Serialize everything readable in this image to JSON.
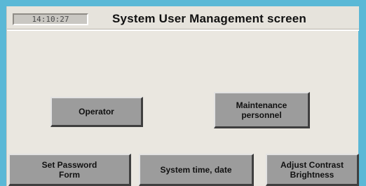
{
  "header": {
    "clock": "14:10:27",
    "title": "System User Management screen"
  },
  "buttons": {
    "operator": "Operator",
    "maintenance": "Maintenance\npersonnel",
    "set_password": "Set Password\nForm",
    "system_time": "System time, date",
    "adjust_contrast": "Adjust Contrast\nBrightness"
  },
  "colors": {
    "frame": "#5ab8d6",
    "panel": "#eae7e0",
    "button_face": "#9c9c9c"
  }
}
